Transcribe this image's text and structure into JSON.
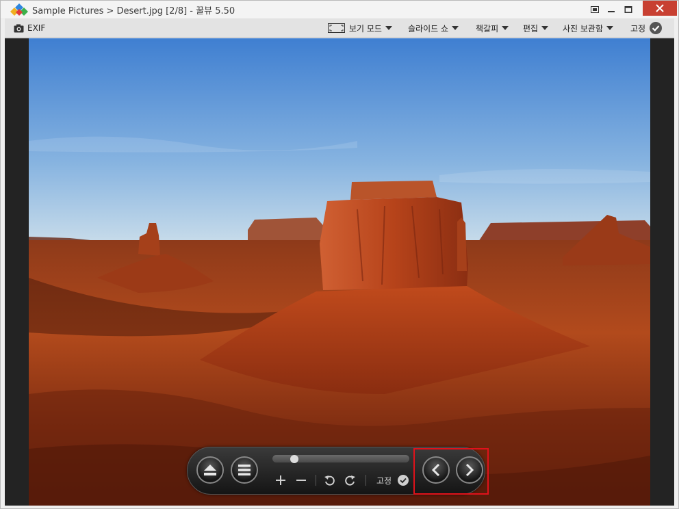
{
  "window": {
    "title": "Sample Pictures > Desert.jpg  [2/8]  - 꿀뷰 5.50"
  },
  "toolbar": {
    "exif_label": "EXIF",
    "view_mode_label": "보기 모드",
    "slideshow_label": "슬라이드 쇼",
    "bookmark_label": "책갈피",
    "edit_label": "편집",
    "photo_archive_label": "사진 보관함",
    "pin_label": "고정"
  },
  "viewer": {
    "image_subject": "desert butte landscape",
    "colors": {
      "sky_top": "#3f7fd1",
      "sky_horizon": "#bcd6ea",
      "rock": "#b6431a",
      "ground": "#7a2a10"
    }
  },
  "control_bar": {
    "pin_label": "고정",
    "zoom_slider_value": 0.16,
    "icons": [
      "eject-icon",
      "menu-icon",
      "zoom-in-icon",
      "zoom-out-icon",
      "rotate-left-icon",
      "rotate-right-icon",
      "check-icon",
      "previous-icon",
      "next-icon"
    ]
  },
  "highlight": {
    "color": "#e0121b",
    "target": "navigation-buttons"
  }
}
